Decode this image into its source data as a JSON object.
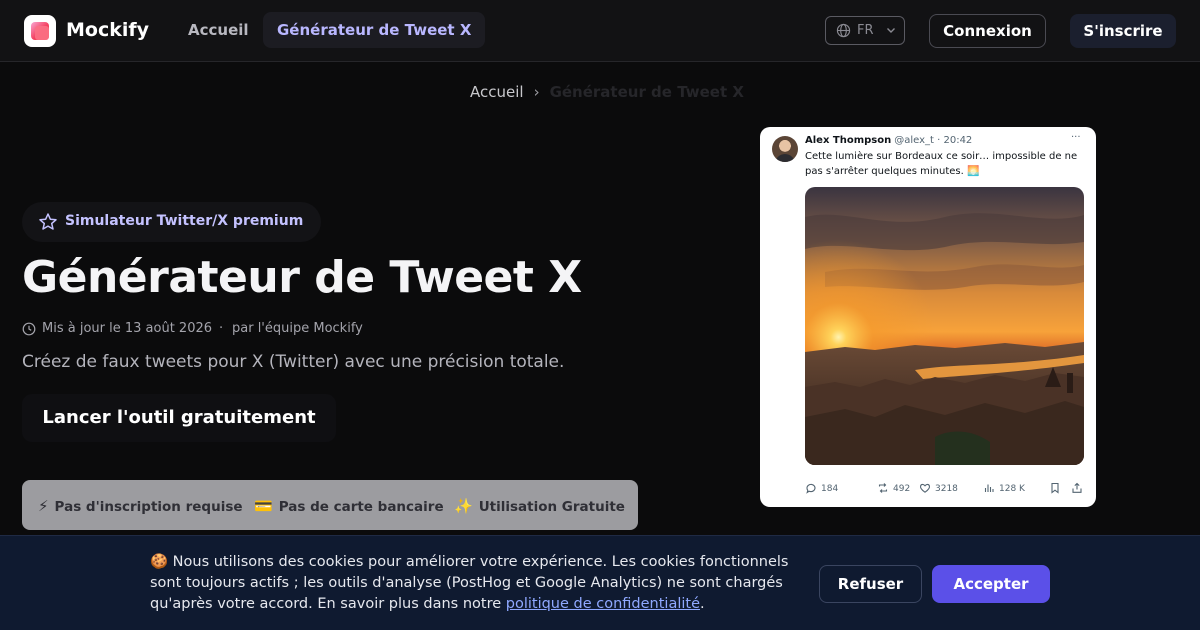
{
  "nav": {
    "brand": "Mockify",
    "home": "Accueil",
    "active": "Générateur de Tweet X",
    "lang": "FR",
    "login": "Connexion",
    "signup": "S'inscrire"
  },
  "breadcrumb": {
    "home": "Accueil",
    "separator": "›",
    "current": "Générateur de Tweet X"
  },
  "hero": {
    "badge": "Simulateur Twitter/X premium",
    "title": "Générateur de Tweet X",
    "updated": "Mis à jour le 13 août 2026",
    "dot": "·",
    "author": "par l'équipe Mockify",
    "lead": "Créez de faux tweets pour X (Twitter) avec une précision totale.",
    "cta": "Lancer l'outil gratuitement",
    "features": [
      {
        "icon": "⚡",
        "label": "Pas d'inscription requise"
      },
      {
        "icon": "💳",
        "label": "Pas de carte bancaire"
      },
      {
        "icon": "✨",
        "label": "Utilisation Gratuite"
      }
    ]
  },
  "tweet": {
    "name": "Alex Thompson",
    "handle": "@alex_t · 20:42",
    "more": "···",
    "text": "Cette lumière sur Bordeaux ce soir… impossible de ne pas s'arrêter quelques minutes. 🌅",
    "replies": "184",
    "retweets": "492",
    "likes": "3218",
    "views": "128 K"
  },
  "cookie": {
    "text": "🍪 Nous utilisons des cookies pour améliorer votre expérience. Les cookies fonctionnels sont toujours actifs ; les outils d'analyse (PostHog et Google Analytics) ne sont chargés qu'après votre accord. En savoir plus dans notre ",
    "link": "politique de confidentialité",
    "end": ".",
    "refuse": "Refuser",
    "accept": "Accepter"
  },
  "colors": {
    "accent": "#5b50e8",
    "active_link": "#b9b7ff",
    "banner_bg": "#0f1a30"
  }
}
